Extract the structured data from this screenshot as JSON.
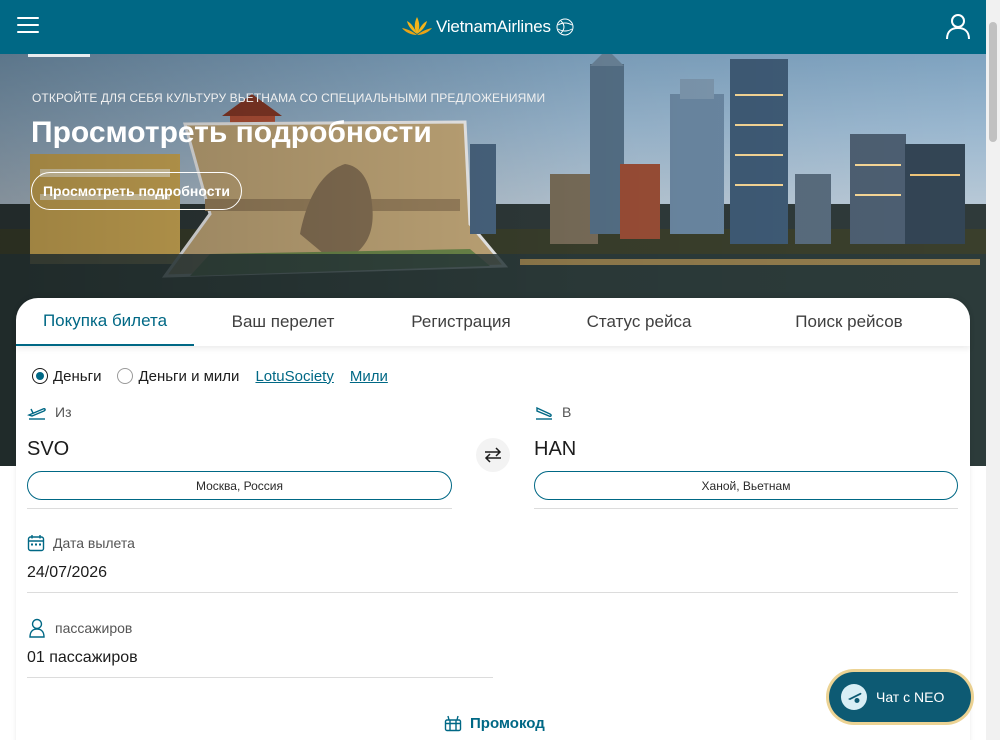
{
  "header": {
    "brand_name": "VietnamAirlines",
    "menu_icon": "hamburger-menu-icon",
    "account_icon": "user-icon",
    "brand_color": "#006885"
  },
  "hero": {
    "kicker": "ОТКРОЙТЕ ДЛЯ СЕБЯ КУЛЬТУРУ ВЬЕТНАМА СО СПЕЦИАЛЬНЫМИ ПРЕДЛОЖЕНИЯМИ",
    "title": "Просмотреть подробности",
    "button_label": "Просмотреть подробности"
  },
  "booking": {
    "tabs": [
      {
        "label": "Покупка билета",
        "active": true
      },
      {
        "label": "Ваш перелет",
        "active": false
      },
      {
        "label": "Регистрация",
        "active": false
      },
      {
        "label": "Статус рейса",
        "active": false
      },
      {
        "label": "Поиск рейсов",
        "active": false
      }
    ],
    "payment": {
      "option_money": "Деньги",
      "option_money_miles": "Деньги и мили",
      "link_lotus": "LotuSociety",
      "link_miles": "Мили",
      "selected": "Деньги"
    },
    "from": {
      "label": "Из",
      "code": "SVO",
      "city": "Москва, Россия"
    },
    "to": {
      "label": "В",
      "code": "HAN",
      "city": "Ханой, Вьетнам"
    },
    "date": {
      "label": "Дата вылета",
      "value": "24/07/2026"
    },
    "passengers": {
      "label": "пассажиров",
      "value": "01 пассажиров"
    },
    "promo_code_label": "Промокод"
  },
  "chat": {
    "label": "Чат с NEO"
  }
}
